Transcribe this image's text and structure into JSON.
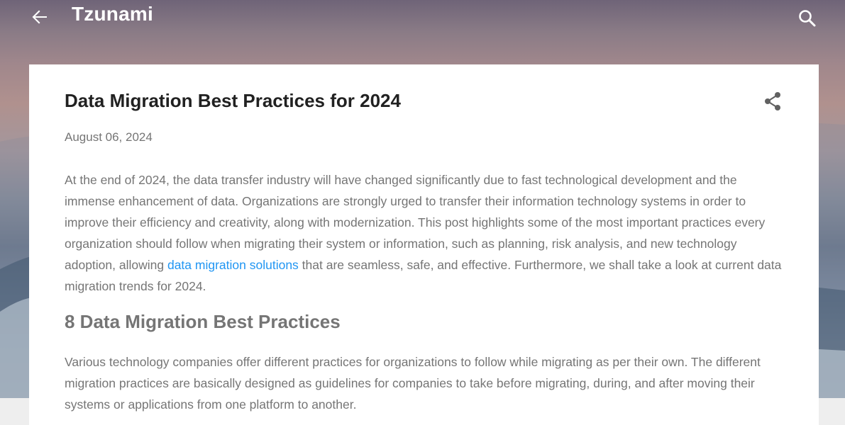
{
  "header": {
    "blog_title": "Tzunami",
    "back_icon": "arrow-left-icon",
    "search_icon": "search-icon"
  },
  "post": {
    "title": "Data Migration Best Practices for 2024",
    "date": "August 06, 2024",
    "share_icon": "share-icon",
    "intro_before_link": "At the end of 2024, the data transfer industry will have changed significantly due to fast technological development and the immense enhancement of data. Organizations are strongly urged to transfer their information technology systems in order to improve their efficiency and creativity, along with modernization. This post highlights some of the most important practices every organization should follow when migrating their system or information, such as planning, risk analysis, and new technology adoption, allowing ",
    "intro_link": "data migration solutions",
    "intro_after_link": " that are seamless, safe, and effective. Furthermore, we shall take a look at current data migration trends for 2024.",
    "section_heading": "8 Data Migration Best Practices",
    "section_paragraph": "Various technology companies offer different practices for organizations to follow while migrating as per their own. The different migration practices are basically designed as guidelines for companies to take before migrating, during, and after moving their systems or applications from one platform to another."
  },
  "colors": {
    "link": "#2196f3",
    "title_text": "#212121",
    "body_text": "#757575",
    "header_text": "#ffffff"
  }
}
